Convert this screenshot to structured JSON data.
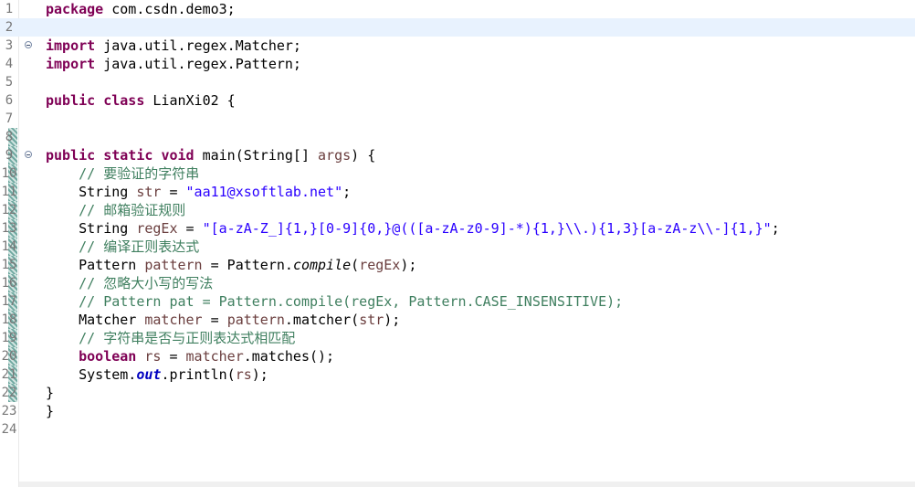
{
  "editor": {
    "lines": [
      {
        "n": "1",
        "parts": [
          [
            "kw",
            "package"
          ],
          [
            "p",
            " com.csdn.demo3;"
          ]
        ]
      },
      {
        "n": "2",
        "current": true,
        "parts": []
      },
      {
        "n": "3",
        "fold": true,
        "parts": [
          [
            "kw",
            "import"
          ],
          [
            "p",
            " java.util.regex.Matcher;"
          ]
        ]
      },
      {
        "n": "4",
        "parts": [
          [
            "kw",
            "import"
          ],
          [
            "p",
            " java.util.regex.Pattern;"
          ]
        ]
      },
      {
        "n": "5",
        "parts": []
      },
      {
        "n": "6",
        "parts": [
          [
            "kw",
            "public"
          ],
          [
            "p",
            " "
          ],
          [
            "kw",
            "class"
          ],
          [
            "p",
            " LianXi02 {"
          ]
        ]
      },
      {
        "n": "7",
        "parts": []
      },
      {
        "n": "8",
        "changed": true,
        "parts": []
      },
      {
        "n": "9",
        "fold": true,
        "changed": true,
        "parts": [
          [
            "kw",
            "public"
          ],
          [
            "p",
            " "
          ],
          [
            "kw",
            "static"
          ],
          [
            "p",
            " "
          ],
          [
            "kw",
            "void"
          ],
          [
            "p",
            " main(String[] "
          ],
          [
            "var",
            "args"
          ],
          [
            "p",
            ") {"
          ]
        ]
      },
      {
        "n": "10",
        "changed": true,
        "parts": [
          [
            "p",
            "    "
          ],
          [
            "cmt",
            "// 要验证的字符串"
          ]
        ]
      },
      {
        "n": "11",
        "changed": true,
        "parts": [
          [
            "p",
            "    String "
          ],
          [
            "var",
            "str"
          ],
          [
            "p",
            " = "
          ],
          [
            "str",
            "\"aa11@xsoftlab.net\""
          ],
          [
            "p",
            ";"
          ]
        ]
      },
      {
        "n": "12",
        "changed": true,
        "parts": [
          [
            "p",
            "    "
          ],
          [
            "cmt",
            "// 邮箱验证规则"
          ]
        ]
      },
      {
        "n": "13",
        "changed": true,
        "parts": [
          [
            "p",
            "    String "
          ],
          [
            "var",
            "regEx"
          ],
          [
            "p",
            " = "
          ],
          [
            "str",
            "\"[a-zA-Z_]{1,}[0-9]{0,}@(([a-zA-z0-9]-*){1,}\\\\.){1,3}[a-zA-z\\\\-]{1,}\""
          ],
          [
            "p",
            ";"
          ]
        ]
      },
      {
        "n": "14",
        "changed": true,
        "parts": [
          [
            "p",
            "    "
          ],
          [
            "cmt",
            "// 编译正则表达式"
          ]
        ]
      },
      {
        "n": "15",
        "changed": true,
        "parts": [
          [
            "p",
            "    Pattern "
          ],
          [
            "var",
            "pattern"
          ],
          [
            "p",
            " = Pattern."
          ],
          [
            "ital",
            "compile"
          ],
          [
            "p",
            "("
          ],
          [
            "var",
            "regEx"
          ],
          [
            "p",
            ");"
          ]
        ]
      },
      {
        "n": "16",
        "changed": true,
        "parts": [
          [
            "p",
            "    "
          ],
          [
            "cmt",
            "// 忽略大小写的写法"
          ]
        ]
      },
      {
        "n": "17",
        "changed": true,
        "parts": [
          [
            "p",
            "    "
          ],
          [
            "cmt",
            "// Pattern pat = Pattern.compile(regEx, Pattern.CASE_INSENSITIVE);"
          ]
        ]
      },
      {
        "n": "18",
        "changed": true,
        "parts": [
          [
            "p",
            "    Matcher "
          ],
          [
            "var",
            "matcher"
          ],
          [
            "p",
            " = "
          ],
          [
            "var",
            "pattern"
          ],
          [
            "p",
            ".matcher("
          ],
          [
            "var",
            "str"
          ],
          [
            "p",
            ");"
          ]
        ]
      },
      {
        "n": "19",
        "changed": true,
        "parts": [
          [
            "p",
            "    "
          ],
          [
            "cmt",
            "// 字符串是否与正则表达式相匹配"
          ]
        ]
      },
      {
        "n": "20",
        "changed": true,
        "parts": [
          [
            "p",
            "    "
          ],
          [
            "kw",
            "boolean"
          ],
          [
            "p",
            " "
          ],
          [
            "var",
            "rs"
          ],
          [
            "p",
            " = "
          ],
          [
            "var",
            "matcher"
          ],
          [
            "p",
            ".matches();"
          ]
        ]
      },
      {
        "n": "21",
        "changed": true,
        "parts": [
          [
            "p",
            "    System."
          ],
          [
            "stat",
            "out"
          ],
          [
            "p",
            ".println("
          ],
          [
            "var",
            "rs"
          ],
          [
            "p",
            ");"
          ]
        ]
      },
      {
        "n": "22",
        "changed": true,
        "parts": [
          [
            "p",
            "}"
          ]
        ]
      },
      {
        "n": "23",
        "parts": [
          [
            "p",
            "}"
          ]
        ]
      },
      {
        "n": "24",
        "parts": []
      }
    ]
  }
}
